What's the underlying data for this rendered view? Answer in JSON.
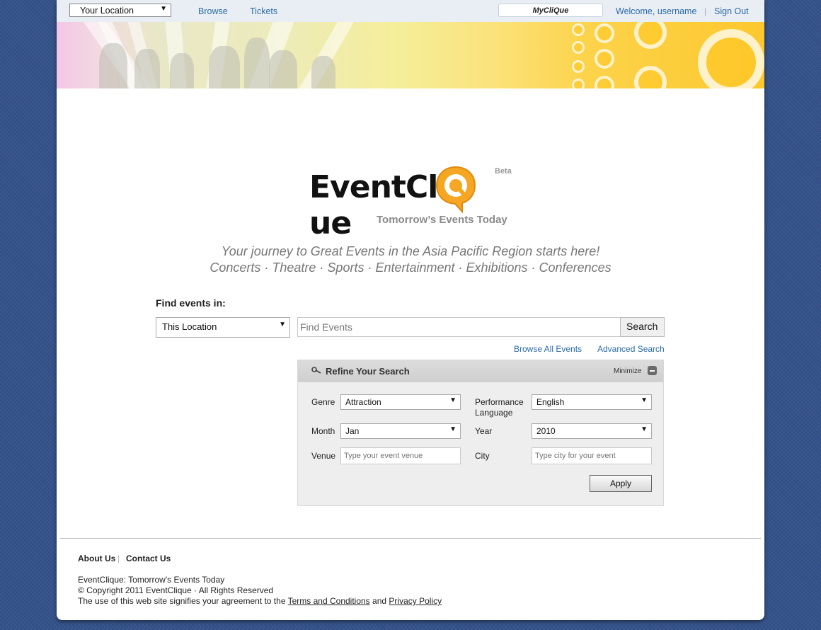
{
  "topbar": {
    "location_select": "Your Location",
    "browse": "Browse",
    "tickets": "Tickets",
    "myclique": "MyCliQue",
    "welcome": "Welcome, username",
    "sign_out": "Sign Out"
  },
  "logo": {
    "name": "EventCliQue",
    "beta": "Beta",
    "tagline": "Tomorrow’s Events Today"
  },
  "intro": {
    "line1": "Your journey to Great Events in the Asia Pacific Region starts here!",
    "line2": "Concerts · Theatre · Sports · Entertainment · Exhibitions · Conferences"
  },
  "search": {
    "find_label": "Find events in:",
    "location": "This Location",
    "placeholder": "Find Events",
    "button": "Search",
    "browse_all": "Browse All Events",
    "advanced": "Advanced Search"
  },
  "refine": {
    "title": "Refine Your Search",
    "minimize": "Minimize",
    "genre_label": "Genre",
    "genre_value": "Attraction",
    "perf_lang_label": "Performance Language",
    "perf_lang_value": "English",
    "month_label": "Month",
    "month_value": "Jan",
    "year_label": "Year",
    "year_value": "2010",
    "venue_label": "Venue",
    "venue_placeholder": "Type your event venue",
    "city_label": "City",
    "city_placeholder": "Type city for your event",
    "apply": "Apply"
  },
  "footer": {
    "about": "About Us",
    "contact": "Contact Us",
    "line1": "EventClique: Tomorrow's Events Today",
    "line2": "© Copyright 2011 EventClique · All Rights Reserved",
    "line3_prefix": "The use of this web site signifies your agreement to the",
    "terms": "Terms and Conditions",
    "and": "and",
    "privacy": "Privacy Policy"
  },
  "colors": {
    "link": "#2a6aa6",
    "logo_orange": "#f5a623",
    "background": "#34528a"
  }
}
